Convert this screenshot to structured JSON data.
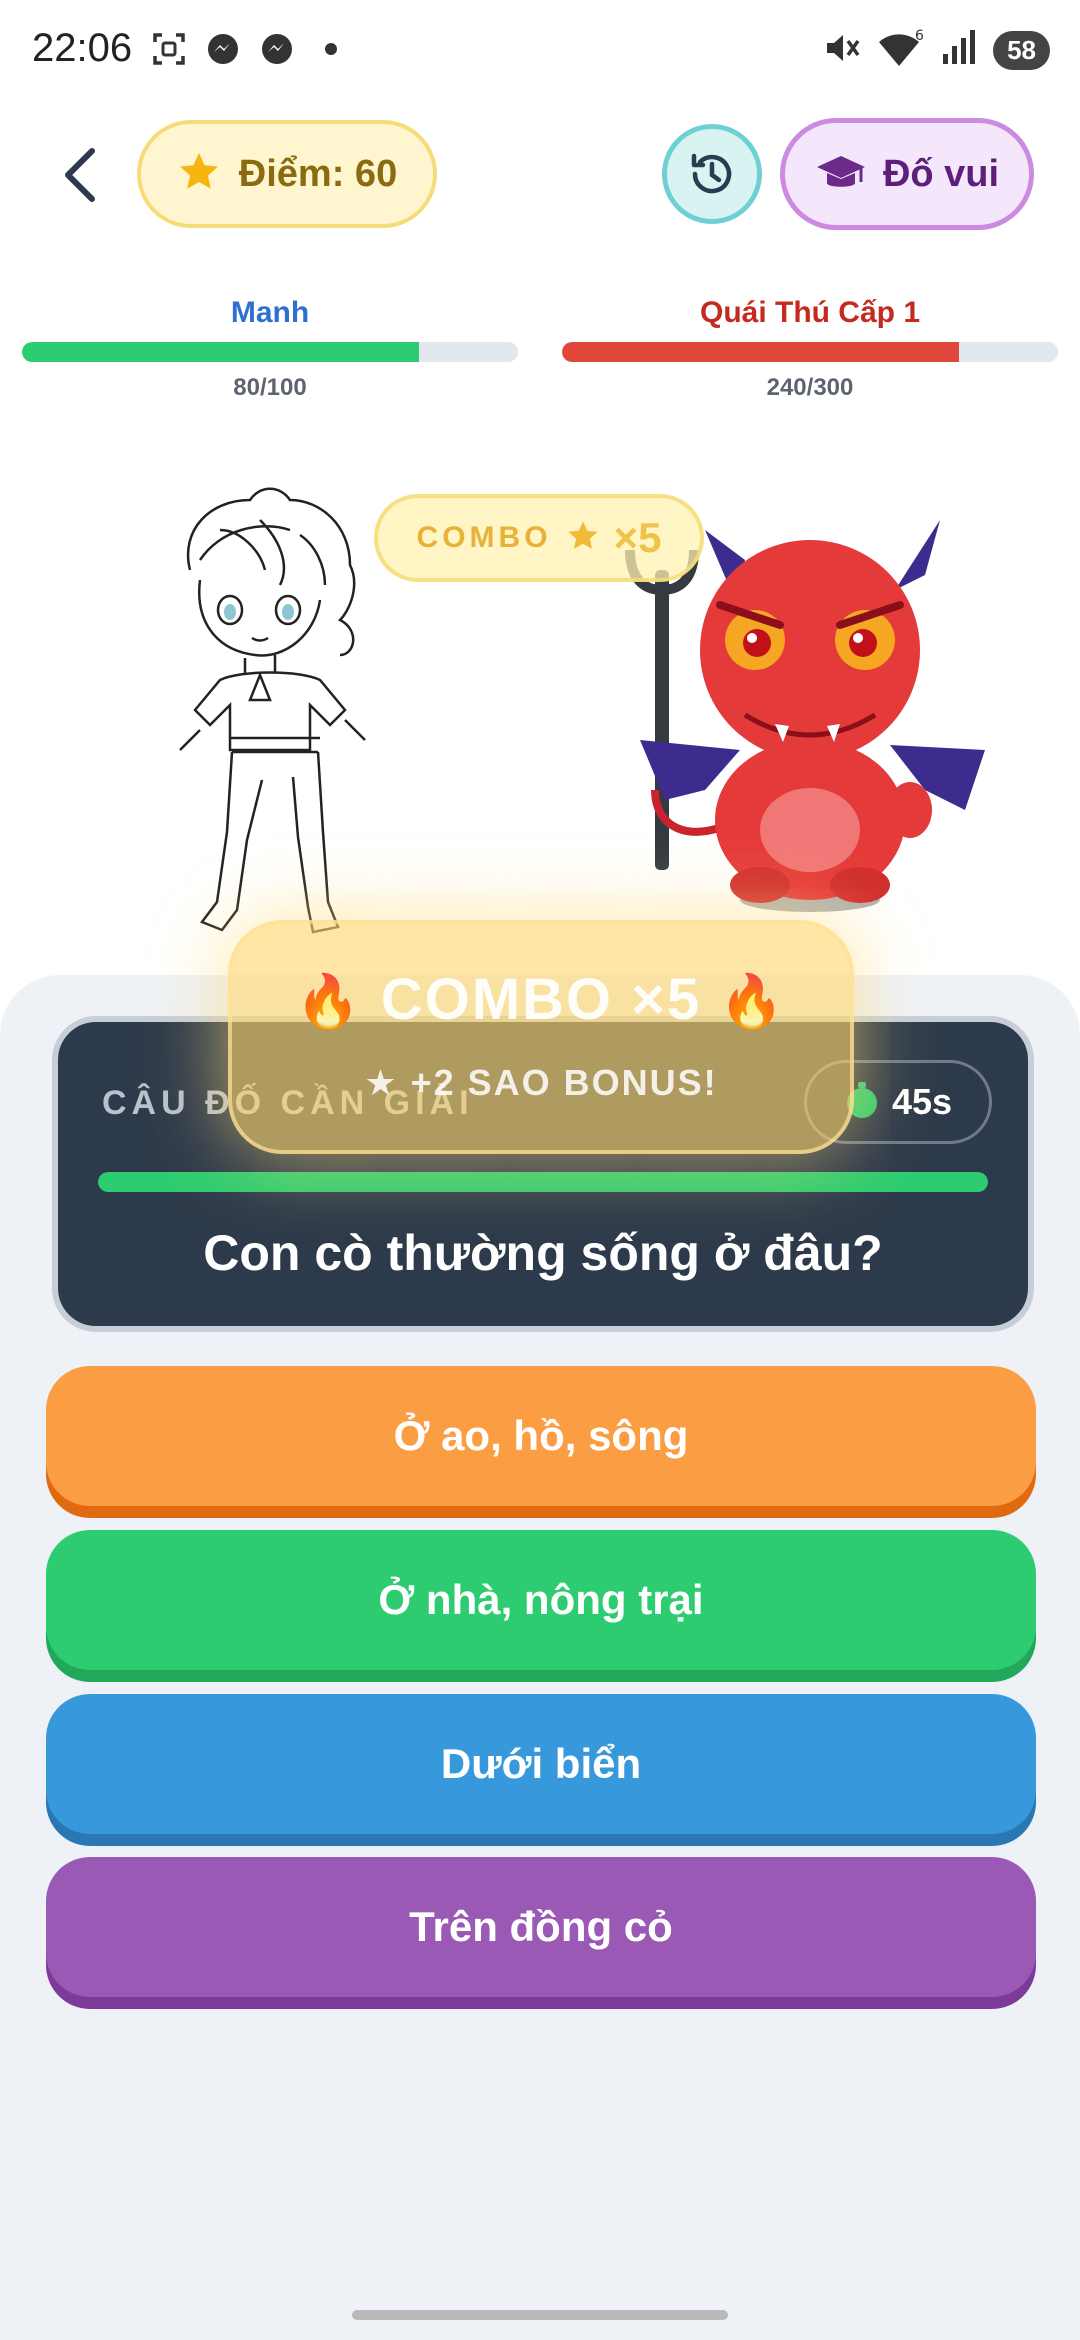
{
  "status_bar": {
    "time": "22:06",
    "battery": "58",
    "wifi_badge": "6",
    "icons": [
      "screenshot-icon",
      "messenger-icon",
      "messenger-icon",
      "dot-icon"
    ]
  },
  "header": {
    "score_label": "Điểm: 60",
    "quiz_label": "Đố vui"
  },
  "player": {
    "name": "Manh",
    "hp_text": "80/100",
    "hp_fraction": 0.8,
    "color": "#2ecc71",
    "name_color": "#2f6fd0"
  },
  "enemy": {
    "name": "Quái Thú Cấp 1",
    "hp_text": "240/300",
    "hp_fraction": 0.8,
    "color": "#e0473b",
    "name_color": "#c42a1f"
  },
  "combo_tag": {
    "label": "COMBO",
    "multiplier": "×5"
  },
  "combo_overlay": {
    "title": "COMBO ×5",
    "subtitle": "+2 SAO BONUS!"
  },
  "question": {
    "label": "CÂU ĐỐ CẦN GIẢI",
    "timer": "45s",
    "progress_fraction": 1.0,
    "text": "Con cò thường sống ở đâu?"
  },
  "answers": [
    {
      "label": "Ở ao, hồ, sông",
      "color": "#fb9d42"
    },
    {
      "label": "Ở nhà, nông trại",
      "color": "#2ecc71"
    },
    {
      "label": "Dưới biển",
      "color": "#3799db"
    },
    {
      "label": "Trên đồng cỏ",
      "color": "#9b59b6"
    }
  ]
}
